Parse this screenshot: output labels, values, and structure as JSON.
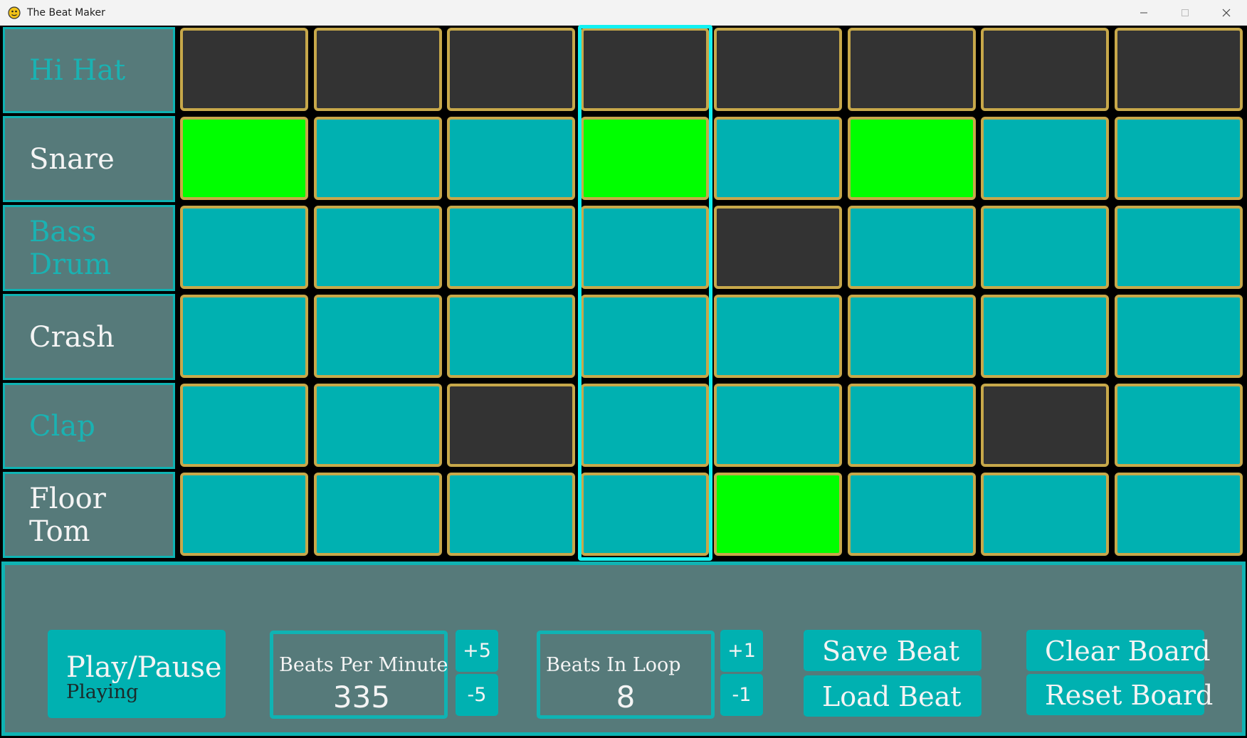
{
  "window": {
    "title": "The Beat Maker",
    "icon": "python-snake-icon"
  },
  "colors": {
    "label_bg": "#567a7a",
    "cyan_border": "#0fb3b3",
    "cell_off": "#00b1b1",
    "cell_on": "#00ff00",
    "cell_disabled": "#333333",
    "cell_border": "#c7a84a",
    "playhead": "#12f1f1"
  },
  "instruments": [
    {
      "name": "Hi Hat",
      "enabled": false
    },
    {
      "name": "Snare",
      "enabled": true
    },
    {
      "name": "Bass Drum",
      "enabled": false
    },
    {
      "name": "Crash",
      "enabled": true
    },
    {
      "name": "Clap",
      "enabled": false
    },
    {
      "name": "Floor Tom",
      "enabled": true
    }
  ],
  "grid": {
    "columns": 8,
    "active_column": 4,
    "states": [
      [
        "disabled",
        "disabled",
        "disabled",
        "disabled",
        "disabled",
        "disabled",
        "disabled",
        "disabled"
      ],
      [
        "on",
        "off",
        "off",
        "on",
        "off",
        "on",
        "off",
        "off"
      ],
      [
        "off",
        "off",
        "off",
        "off",
        "disabled",
        "off",
        "off",
        "off"
      ],
      [
        "off",
        "off",
        "off",
        "off",
        "off",
        "off",
        "off",
        "off"
      ],
      [
        "off",
        "off",
        "disabled",
        "off",
        "off",
        "off",
        "disabled",
        "off"
      ],
      [
        "off",
        "off",
        "off",
        "off",
        "on",
        "off",
        "off",
        "off"
      ]
    ]
  },
  "controls": {
    "play_pause": {
      "label": "Play/Pause",
      "status": "Playing"
    },
    "bpm": {
      "label": "Beats Per Minute",
      "value": "335",
      "up": "+5",
      "down": "-5"
    },
    "loop": {
      "label": "Beats In Loop",
      "value": "8",
      "up": "+1",
      "down": "-1"
    },
    "save": "Save Beat",
    "load": "Load Beat",
    "clear": "Clear Board",
    "reset": "Reset Board"
  }
}
